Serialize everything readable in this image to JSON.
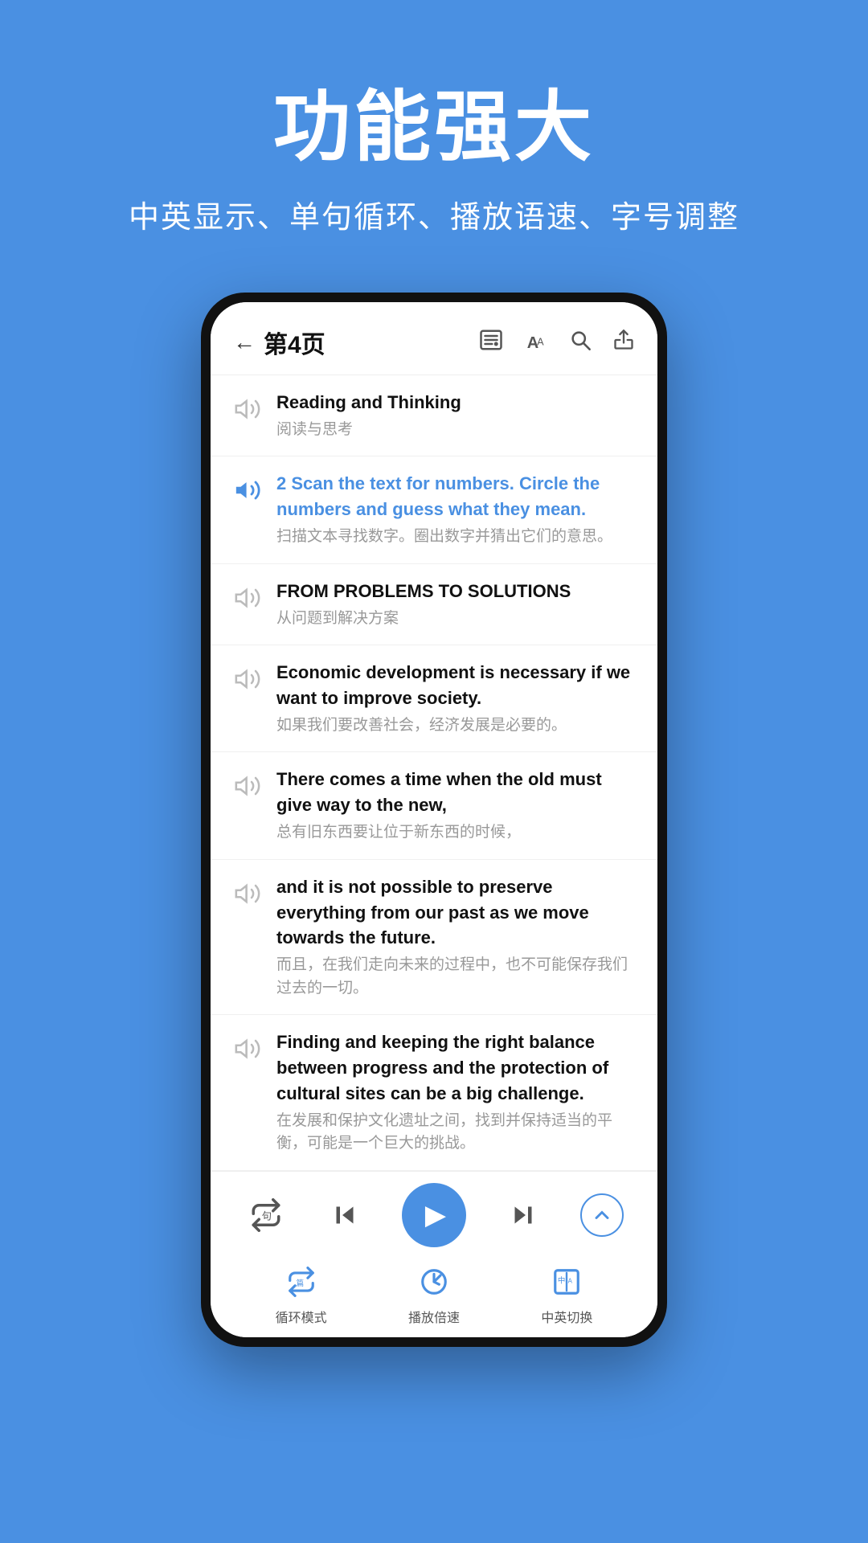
{
  "promo": {
    "title": "功能强大",
    "subtitle": "中英显示、单句循环、播放语速、字号调整"
  },
  "header": {
    "back_label": "←",
    "page_label": "第4页",
    "icons": [
      "list-settings",
      "font-size",
      "search",
      "share"
    ]
  },
  "content_items": [
    {
      "id": 1,
      "english": "Reading and Thinking",
      "chinese": "阅读与思考",
      "active": false,
      "bold": false
    },
    {
      "id": 2,
      "english": "2 Scan the text for numbers. Circle the numbers and guess what they mean.",
      "chinese": "扫描文本寻找数字。圈出数字并猜出它们的意思。",
      "active": true,
      "blue": true,
      "bold": false
    },
    {
      "id": 3,
      "english": "FROM PROBLEMS TO SOLUTIONS",
      "chinese": "从问题到解决方案",
      "active": false,
      "bold": true
    },
    {
      "id": 4,
      "english": "Economic development is necessary if we want to improve society.",
      "chinese": "如果我们要改善社会，经济发展是必要的。",
      "active": false,
      "bold": false
    },
    {
      "id": 5,
      "english": "There comes a time when the old must give way to the new,",
      "chinese": "总有旧东西要让位于新东西的时候，",
      "active": false,
      "bold": false
    },
    {
      "id": 6,
      "english": "and it is not possible to preserve everything from our past as we move towards the future.",
      "chinese": "而且，在我们走向未来的过程中，也不可能保存我们过去的一切。",
      "active": false,
      "bold": false
    },
    {
      "id": 7,
      "english": "Finding and keeping the right balance between progress and the protection of cultural sites can be a big challenge.",
      "chinese": "在发展和保护文化遗址之间，找到并保持适当的平衡，可能是一个巨大的挑战。",
      "active": false,
      "bold": false
    }
  ],
  "player": {
    "loop_label": "循环模式",
    "speed_label": "播放倍速",
    "lang_label": "中英切换"
  }
}
